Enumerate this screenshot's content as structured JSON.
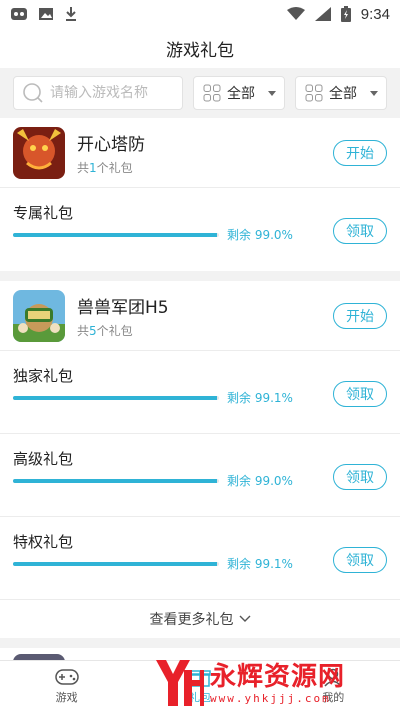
{
  "status_bar": {
    "time": "9:34"
  },
  "header": {
    "title": "游戏礼包"
  },
  "search": {
    "placeholder": "请输入游戏名称"
  },
  "filters": [
    {
      "value": "全部"
    },
    {
      "value": "全部"
    }
  ],
  "games": [
    {
      "name": "开心塔防",
      "count_prefix": "共",
      "count": "1",
      "count_suffix": "个礼包",
      "start_label": "开始",
      "gifts": [
        {
          "name": "专属礼包",
          "remain_text": "剩余 99.0%",
          "remain_pct": 99.0,
          "action": "领取"
        }
      ]
    },
    {
      "name": "兽兽军团H5",
      "count_prefix": "共",
      "count": "5",
      "count_suffix": "个礼包",
      "start_label": "开始",
      "gifts": [
        {
          "name": "独家礼包",
          "remain_text": "剩余 99.1%",
          "remain_pct": 99.1,
          "action": "领取"
        },
        {
          "name": "高级礼包",
          "remain_text": "剩余 99.0%",
          "remain_pct": 99.0,
          "action": "领取"
        },
        {
          "name": "特权礼包",
          "remain_text": "剩余 99.1%",
          "remain_pct": 99.1,
          "action": "领取"
        }
      ],
      "more_label": "查看更多礼包"
    }
  ],
  "tabs": [
    {
      "label": "游戏",
      "icon": "gamepad-icon"
    },
    {
      "label": "礼包",
      "icon": "gift-icon"
    },
    {
      "label": "我的",
      "icon": "user-icon"
    }
  ],
  "watermark": {
    "text": "永辉资源网",
    "url": "www.yhkjjj.com"
  },
  "colors": {
    "accent": "#2fb3d6",
    "watermark": "#e8212a"
  }
}
